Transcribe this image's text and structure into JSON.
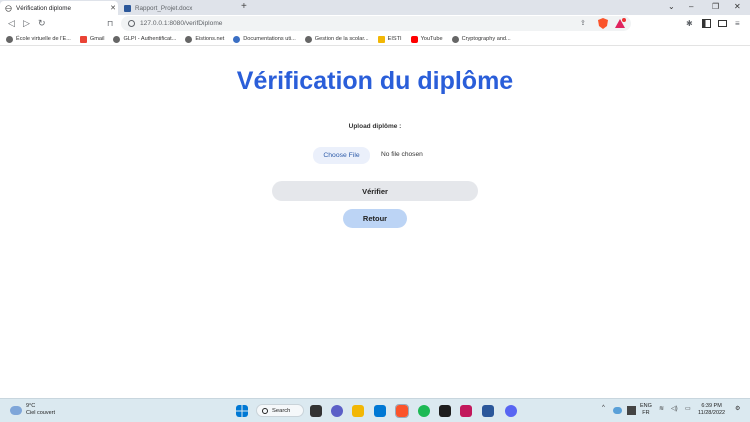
{
  "browser": {
    "tabs": [
      {
        "title": "Vérification diplome",
        "active": true
      },
      {
        "title": "Rapport_Projet.docx",
        "active": false
      }
    ],
    "new_tab_glyph": "+",
    "window_controls": [
      "⌄",
      "–",
      "❐",
      "✕"
    ],
    "address": "127.0.0.1:8080/verifDiplome",
    "bookmarks": [
      {
        "label": "École virtuelle de l'E...",
        "icon": "globe-icon"
      },
      {
        "label": "Gmail",
        "icon": "gmail-icon"
      },
      {
        "label": "GLPI - Authentificat...",
        "icon": "globe-icon"
      },
      {
        "label": "Eistions.net",
        "icon": "globe-icon"
      },
      {
        "label": "Documentations uti...",
        "icon": "globe-icon"
      },
      {
        "label": "Gestion de la scolar...",
        "icon": "globe-icon"
      },
      {
        "label": "EISTI",
        "icon": "folder-icon"
      },
      {
        "label": "YouTube",
        "icon": "youtube-icon"
      },
      {
        "label": "Cryptography and...",
        "icon": "globe-icon"
      }
    ]
  },
  "page": {
    "title": "Vérification du diplôme",
    "upload_label": "Upload diplôme :",
    "choose_file_label": "Choose File",
    "no_file_text": "No file chosen",
    "verify_button": "Vérifier",
    "back_button": "Retour"
  },
  "taskbar": {
    "weather_temp": "9°C",
    "weather_desc": "Ciel couvert",
    "search_label": "Search",
    "lang_top": "ENG",
    "lang_bottom": "FR",
    "time": "6:39 PM",
    "date": "11/28/2022"
  },
  "colors": {
    "title": "#2a5ed9",
    "back_button_bg": "#bcd4f5",
    "verify_button_bg": "#e5e7eb"
  }
}
